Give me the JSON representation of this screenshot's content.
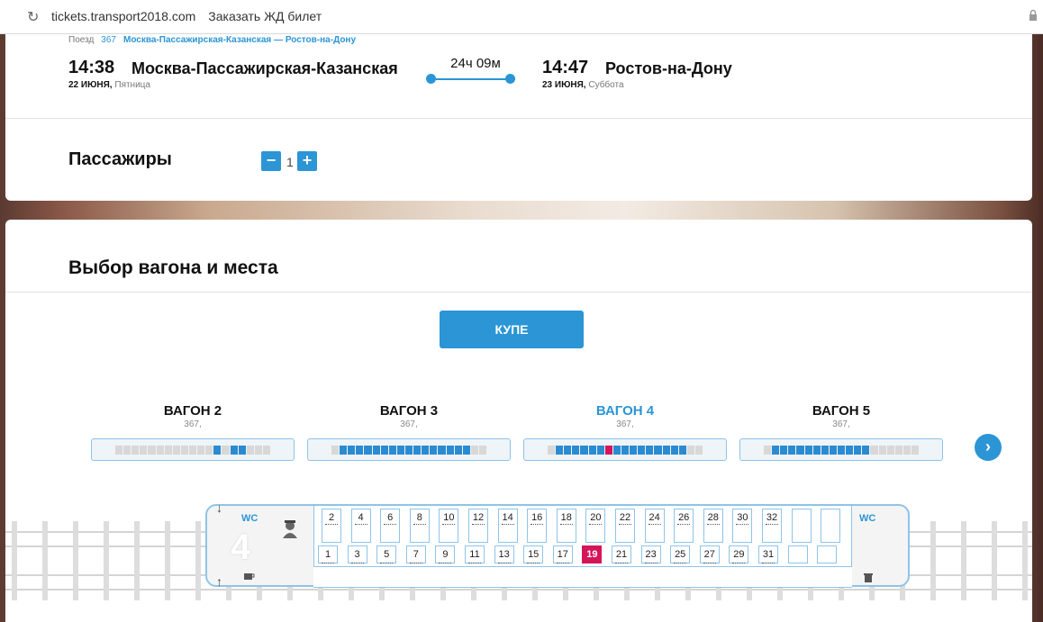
{
  "browser": {
    "url": "tickets.transport2018.com",
    "page_title": "Заказать ЖД билет"
  },
  "train": {
    "label": "Поезд",
    "number": "367",
    "route": "Москва-Пассажирская-Казанская — Ростов-на-Дону",
    "departure": {
      "time": "14:38",
      "city": "Москва-Пассажирская-Казанская",
      "date": "22 ИЮНЯ,",
      "weekday": "Пятница"
    },
    "duration": "24ч 09м",
    "arrival": {
      "time": "14:47",
      "city": "Ростов-на-Дону",
      "date": "23 ИЮНЯ,",
      "weekday": "Суббота"
    }
  },
  "passengers": {
    "title": "Пассажиры",
    "minus": "−",
    "count": "1",
    "plus": "+"
  },
  "selection": {
    "title": "Выбор вагона и места",
    "class_button": "КУПЕ",
    "wagons": [
      {
        "name": "ВАГОН 2",
        "train": "367,",
        "active": false
      },
      {
        "name": "ВАГОН 3",
        "train": "367,",
        "active": false
      },
      {
        "name": "ВАГОН 4",
        "train": "367,",
        "active": true
      },
      {
        "name": "ВАГОН 5",
        "train": "367,",
        "active": false
      }
    ],
    "next": "›"
  },
  "car": {
    "wc_left": "WC",
    "wc_right": "WC",
    "car_number": "4",
    "upper_seats": [
      "2",
      "4",
      "6",
      "8",
      "10",
      "12",
      "14",
      "16",
      "18",
      "20",
      "22",
      "24",
      "26",
      "28",
      "30",
      "32",
      "",
      ""
    ],
    "lower_seats": [
      "1",
      "3",
      "5",
      "7",
      "9",
      "11",
      "13",
      "15",
      "17",
      "19",
      "21",
      "23",
      "25",
      "27",
      "29",
      "31",
      "",
      ""
    ],
    "selected_seat": "19",
    "colors": {
      "accent": "#2b95d6",
      "selected": "#d6145a",
      "taken": "#d8d8d8"
    }
  }
}
